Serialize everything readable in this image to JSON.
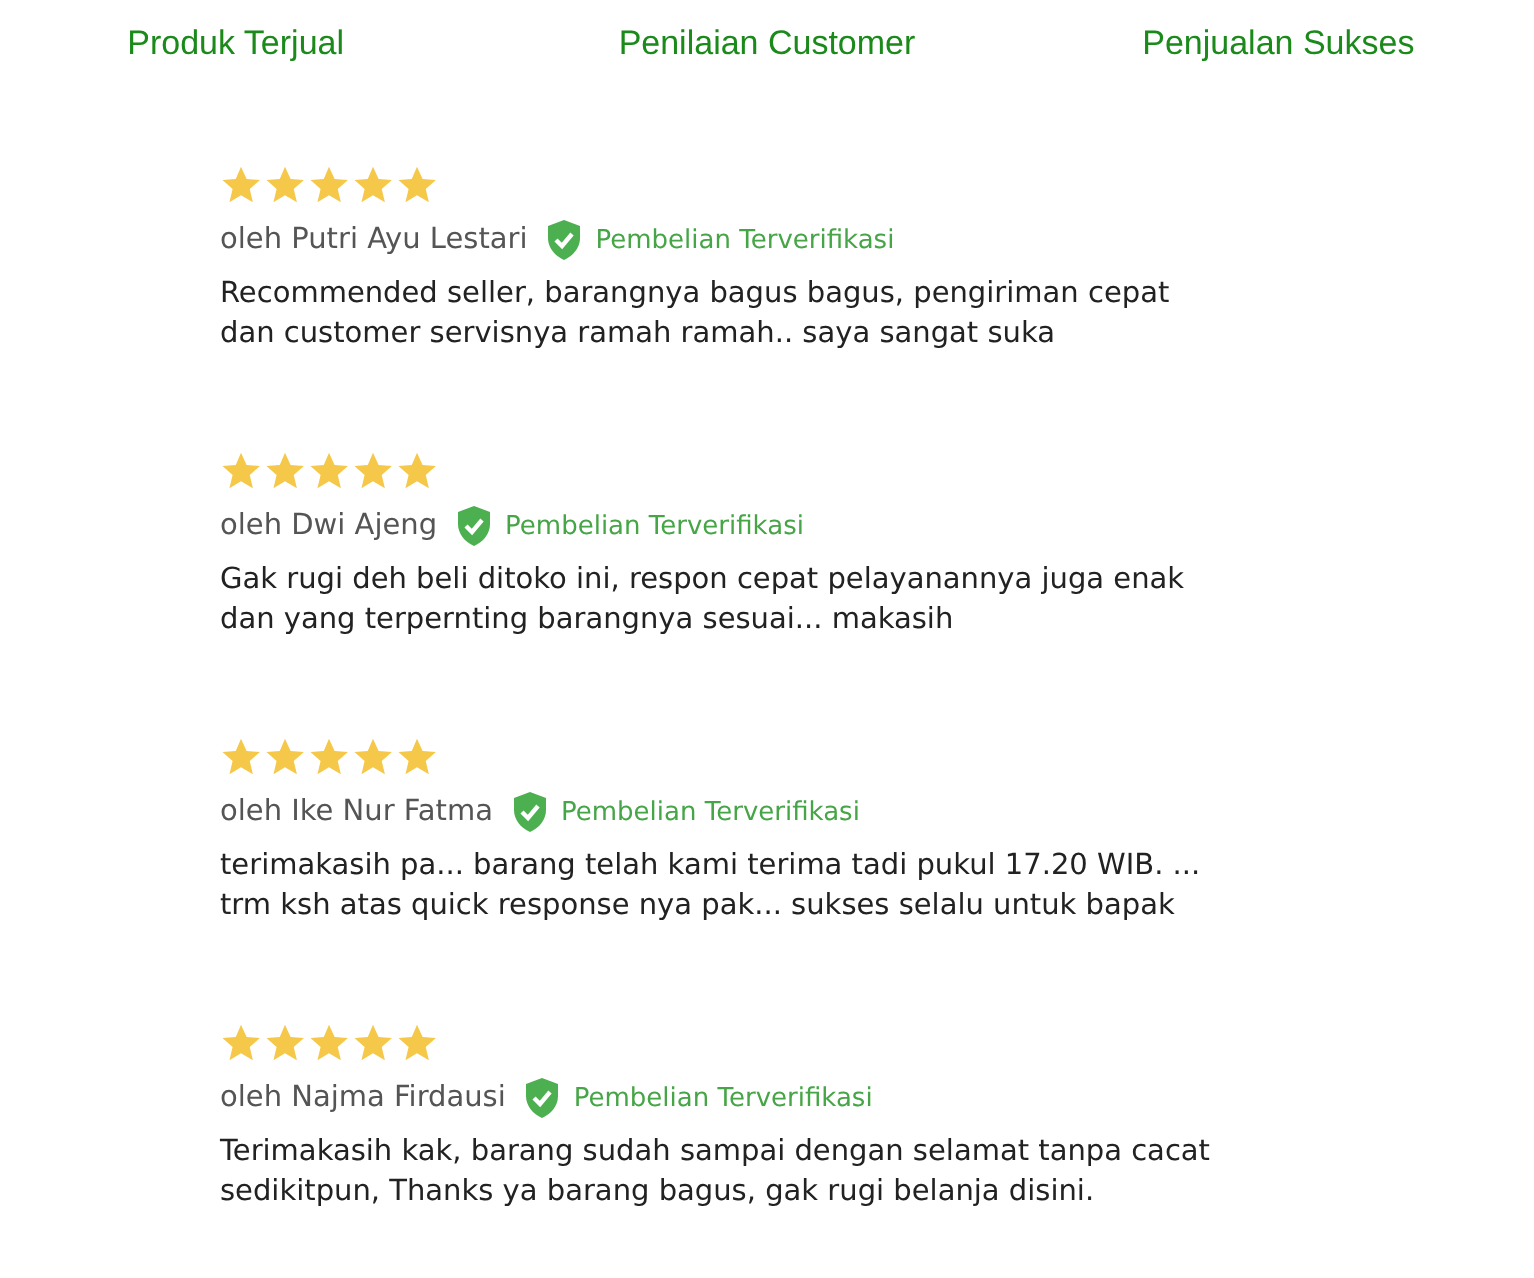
{
  "tabs": [
    {
      "label": "Produk Terjual"
    },
    {
      "label": "Penilaian Customer"
    },
    {
      "label": "Penjualan Sukses"
    }
  ],
  "reviews": [
    {
      "stars": 5,
      "author": "oleh Putri Ayu Lestari",
      "badge": "Pembelian Terverifikasi",
      "lines": [
        "Recommended seller, barangnya bagus bagus, pengiriman cepat",
        "dan customer servisnya ramah ramah.. saya sangat suka"
      ]
    },
    {
      "stars": 5,
      "author": "oleh Dwi Ajeng",
      "badge": "Pembelian Terverifikasi",
      "lines": [
        "Gak rugi deh beli ditoko ini, respon cepat pelayanannya juga enak",
        "dan yang terpernting barangnya sesuai... makasih"
      ]
    },
    {
      "stars": 5,
      "author": "oleh Ike Nur Fatma",
      "badge": "Pembelian Terverifikasi",
      "lines": [
        "terimakasih pa... barang telah kami terima tadi pukul 17.20 WIB. ...",
        "trm ksh atas quick response nya pak... sukses selalu untuk bapak"
      ]
    },
    {
      "stars": 5,
      "author": "oleh Najma Firdausi",
      "badge": "Pembelian Terverifikasi",
      "lines": [
        "Terimakasih kak, barang sudah sampai dengan selamat tanpa cacat",
        "sedikitpun, Thanks ya barang bagus, gak rugi belanja disini."
      ]
    }
  ]
}
